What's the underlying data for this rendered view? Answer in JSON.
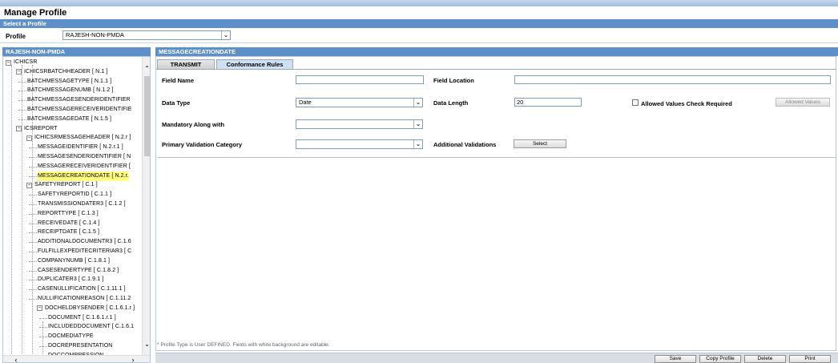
{
  "page": {
    "title": "Manage Profile"
  },
  "select_profile_bar": "Select a Profile",
  "profile": {
    "label": "Profile",
    "selected": "RAJESH-NON-PMDA"
  },
  "tree": {
    "header": "RAJESH-NON-PMDA",
    "items": [
      {
        "label": "ICHICSR",
        "level": 0,
        "expander": true
      },
      {
        "label": "ICHICSRBATCHHEADER [ N.1 ]",
        "level": 1,
        "expander": true
      },
      {
        "label": "BATCHMESSAGETYPE [ N.1.1 ]",
        "level": 2
      },
      {
        "label": "BATCHMESSAGENUMB [ N.1.2 ]",
        "level": 2
      },
      {
        "label": "BATCHMESSAGESENDERIDENTIFIER",
        "level": 2
      },
      {
        "label": "BATCHMESSAGERECEIVERIDENTIFIE",
        "level": 2
      },
      {
        "label": "BATCHMESSAGEDATE [ N.1.5 ]",
        "level": 2
      },
      {
        "label": "ICSREPORT",
        "level": 1,
        "expander": true
      },
      {
        "label": "ICHICSRMESSAGEHEADER [ N.2.r ]",
        "level": 2,
        "expander": true
      },
      {
        "label": "MESSAGEIDENTIFIER [ N.2.r.1 ]",
        "level": 3
      },
      {
        "label": "MESSAGESENDERIDENTIFIER [ N",
        "level": 3
      },
      {
        "label": "MESSAGERECEIVERIDENTIFIER [",
        "level": 3
      },
      {
        "label": "MESSAGECREATIONDATE [ N.2.r.",
        "level": 3,
        "selected": true
      },
      {
        "label": "SAFETYREPORT [ C.1 ]",
        "level": 2,
        "expander": true
      },
      {
        "label": "SAFETYREPORTID [ C.1.1 ]",
        "level": 3
      },
      {
        "label": "TRANSMISSIONDATER3 [ C.1.2 ]",
        "level": 3
      },
      {
        "label": "REPORTTYPE [ C.1.3 ]",
        "level": 3
      },
      {
        "label": "RECEIVEDATE [ C.1.4 ]",
        "level": 3
      },
      {
        "label": "RECEIPTDATE [ C.1.5 ]",
        "level": 3
      },
      {
        "label": "ADDITIONALDOCUMENTR3 [ C.1.6",
        "level": 3
      },
      {
        "label": "FULFILLEXPEDITECRITERIAR3 [ C",
        "level": 3
      },
      {
        "label": "COMPANYNUMB [ C.1.8.1 ]",
        "level": 3
      },
      {
        "label": "CASESENDERTYPE [ C.1.8.2 ]",
        "level": 3
      },
      {
        "label": "DUPLICATER3 [ C.1.9.1 ]",
        "level": 3
      },
      {
        "label": "CASENULLIFICATION [ C.1.11.1 ]",
        "level": 3
      },
      {
        "label": "NULLIFICATIONREASON [ C.1.11.2",
        "level": 3
      },
      {
        "label": "DOCHELDBYSENDER [ C.1.6.1.r ]",
        "level": 3,
        "expander": true
      },
      {
        "label": "DOCUMENT [ C.1.6.1.r.1 ]",
        "level": 4
      },
      {
        "label": "INCLUDEDDOCUMENT [ C.1.6.1",
        "level": 4
      },
      {
        "label": "DOCMEDIATYPE",
        "level": 4
      },
      {
        "label": "DOCREPRESENTATION",
        "level": 4
      },
      {
        "label": "DOCCOMPRESSION",
        "level": 4
      }
    ]
  },
  "detail": {
    "header": "MESSAGECREATIONDATE",
    "tabs": [
      {
        "label": "TRANSMIT"
      },
      {
        "label": "Conformance Rules"
      }
    ],
    "form": {
      "field_name_label": "Field Name",
      "field_name_value": "",
      "field_location_label": "Field Location",
      "field_location_value": "",
      "data_type_label": "Data Type",
      "data_type_value": "Date",
      "data_length_label": "Data Length",
      "data_length_value": "20",
      "allowed_values_check_label": "Allowed Values Check Required",
      "allowed_values_check_checked": false,
      "allowed_values_button": "Allowed Values",
      "mandatory_label": "Mandatory Along with",
      "mandatory_value": "",
      "primary_validation_label": "Primary Validation Category",
      "primary_validation_value": "",
      "additional_validations_label": "Additional Validations",
      "select_button": "Select"
    },
    "footnote": "* Profile Type is User DEFINED. Fields with white background are editable."
  },
  "buttons": {
    "save": "Save",
    "copy_profile": "Copy Profile",
    "delete": "Delete",
    "print": "Print"
  },
  "colors": {
    "header_bar": "#5d8fc8",
    "selected_tree_item": "#ffff80"
  }
}
